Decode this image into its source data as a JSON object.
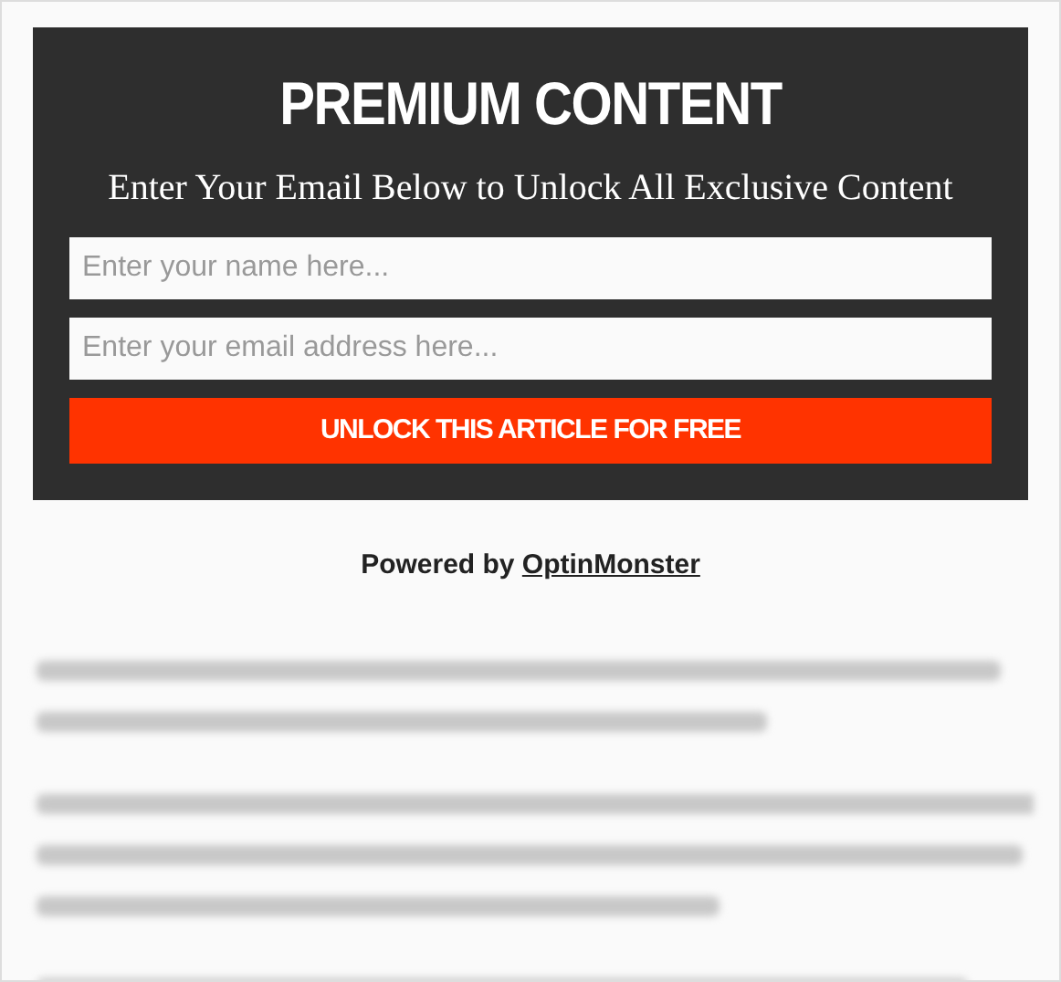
{
  "optin": {
    "title": "PREMIUM CONTENT",
    "subtitle": "Enter Your Email Below to Unlock All Exclusive Content",
    "fields": [
      {
        "placeholder": "Enter your name here..."
      },
      {
        "placeholder": "Enter your email address here..."
      }
    ],
    "button": "UNLOCK THIS ARTICLE FOR FREE"
  },
  "powered_by": {
    "text": "Powered by ",
    "link": "OptinMonster"
  }
}
